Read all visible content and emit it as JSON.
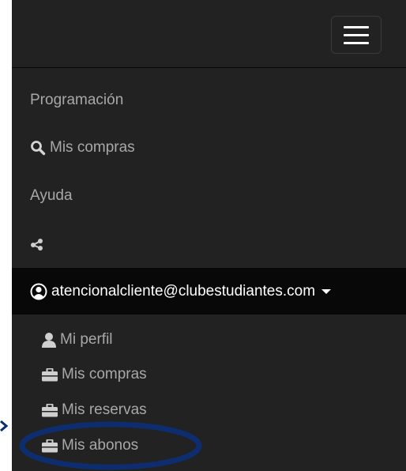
{
  "navbar": {
    "toggle_icon": "hamburger-icon"
  },
  "menu": {
    "programacion": "Programación",
    "mis_compras": "Mis compras",
    "ayuda": "Ayuda",
    "share_icon": "share-icon",
    "search_icon": "search-icon"
  },
  "user": {
    "email": "atencionalcliente@clubestudiantes.com",
    "user_icon": "user-circle-icon",
    "caret_icon": "caret-down-icon"
  },
  "dropdown": {
    "items": [
      {
        "label": "Mi perfil",
        "icon": "user-icon"
      },
      {
        "label": "Mis compras",
        "icon": "briefcase-icon"
      },
      {
        "label": "Mis reservas",
        "icon": "briefcase-icon"
      },
      {
        "label": "Mis abonos",
        "icon": "briefcase-icon"
      }
    ]
  },
  "colors": {
    "panel_bg": "#222222",
    "active_bg": "#080808",
    "link_text": "#a8a8a8",
    "highlight_oval": "#0d2d6e"
  }
}
